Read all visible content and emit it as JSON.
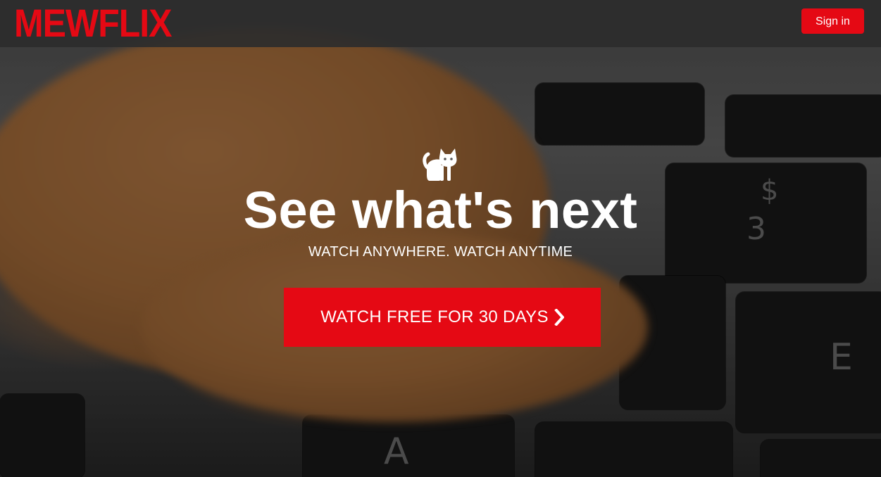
{
  "brand": {
    "logo_text": "MEWFLIX",
    "accent_color": "#e50914"
  },
  "header": {
    "signin_label": "Sign in"
  },
  "hero": {
    "icon": "cat-icon",
    "headline": "See what's next",
    "tagline": "WATCH ANYWHERE. WATCH ANYTIME",
    "cta_label": "WATCH FREE FOR 30 DAYS",
    "cta_icon": "chevron-right-icon"
  },
  "background": {
    "key_labels": [
      "$",
      "3",
      "E",
      "A"
    ]
  }
}
